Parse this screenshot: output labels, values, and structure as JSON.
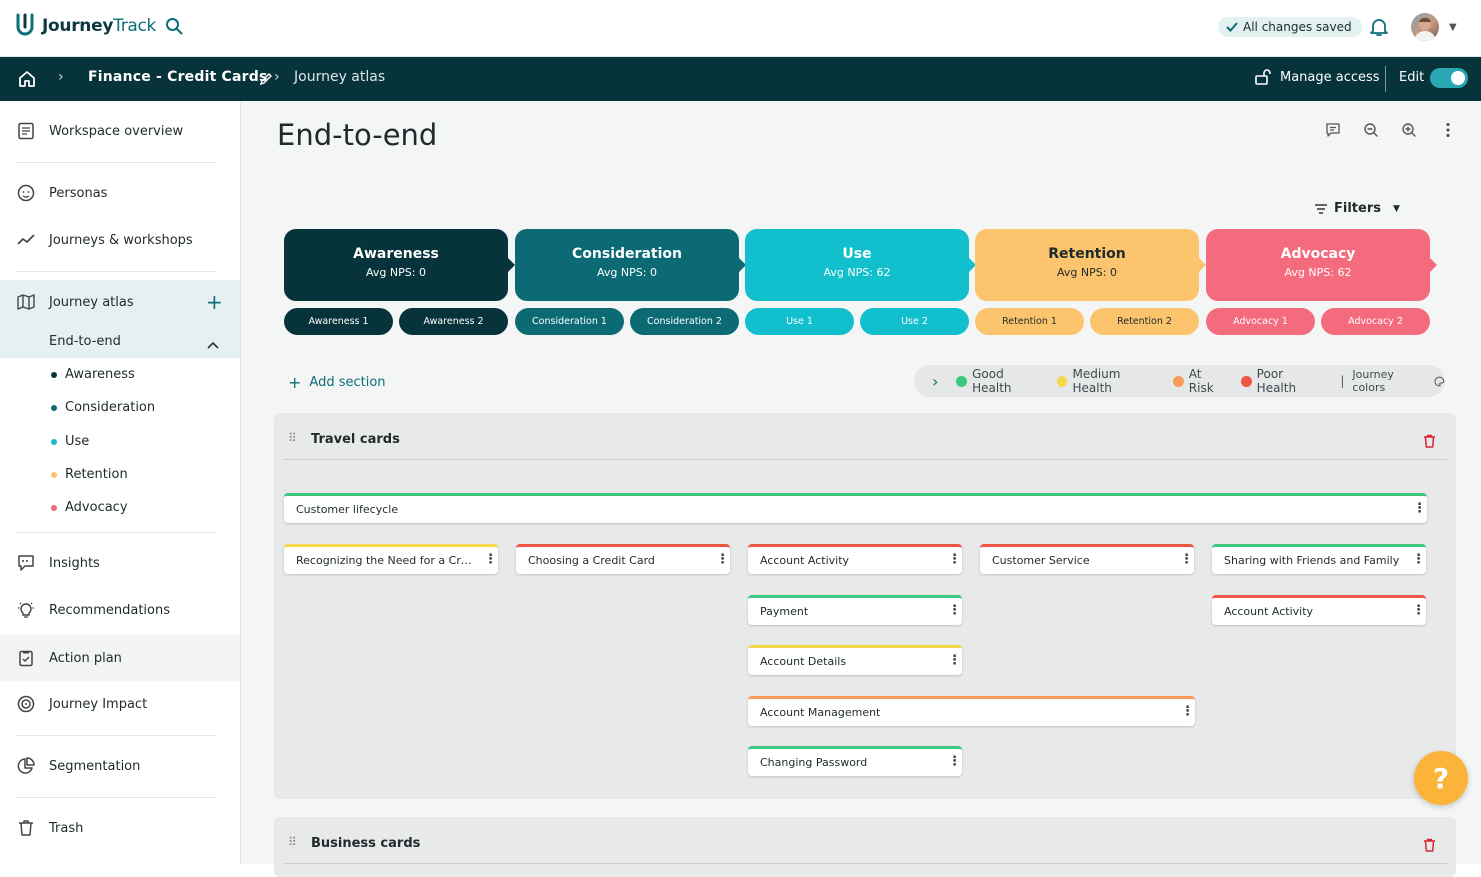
{
  "app": {
    "name_a": "Journey",
    "name_b": "Track",
    "saved_status": "All changes saved"
  },
  "breadcrumb": {
    "workspace": "Finance - Credit Cards",
    "page": "Journey atlas"
  },
  "navbar": {
    "manage_access": "Manage access",
    "edit_label": "Edit",
    "edit_on": true
  },
  "sidebar": {
    "workspace_overview": "Workspace overview",
    "personas": "Personas",
    "journeys": "Journeys & workshops",
    "journey_atlas": "Journey atlas",
    "end_to_end": "End-to-end",
    "phases": [
      {
        "label": "Awareness",
        "color": "#07333a"
      },
      {
        "label": "Consideration",
        "color": "#0d6e78"
      },
      {
        "label": "Use",
        "color": "#14b8c6"
      },
      {
        "label": "Retention",
        "color": "#fbc46a"
      },
      {
        "label": "Advocacy",
        "color": "#f26a7d"
      }
    ],
    "insights": "Insights",
    "recommendations": "Recommendations",
    "action_plan": "Action plan",
    "journey_impact": "Journey Impact",
    "segmentation": "Segmentation",
    "trash": "Trash"
  },
  "main": {
    "title": "End-to-end",
    "filters": "Filters",
    "add_section": "Add section",
    "stages": [
      {
        "name": "Awareness",
        "nps": "Avg NPS: 0",
        "bg": "#07333a",
        "fg": "#ffffff",
        "subs": [
          "Awareness 1",
          "Awareness 2"
        ]
      },
      {
        "name": "Consideration",
        "nps": "Avg NPS: 0",
        "bg": "#0b6a74",
        "fg": "#ffffff",
        "subs": [
          "Consideration 1",
          "Consideration 2"
        ]
      },
      {
        "name": "Use",
        "nps": "Avg NPS: 62",
        "bg": "#12bfcd",
        "fg": "#ffffff",
        "subs": [
          "Use 1",
          "Use 2"
        ]
      },
      {
        "name": "Retention",
        "nps": "Avg NPS: 0",
        "bg": "#fcc46c",
        "fg": "#1e2a2c",
        "subs": [
          "Retention 1",
          "Retention 2"
        ]
      },
      {
        "name": "Advocacy",
        "nps": "Avg NPS: 62",
        "bg": "#f56b7e",
        "fg": "#ffffff",
        "subs": [
          "Advocacy 1",
          "Advocacy 2"
        ]
      }
    ],
    "legend": {
      "items": [
        {
          "label": "Good Health",
          "color": "#3cc97f"
        },
        {
          "label": "Medium Health",
          "color": "#f2d84a"
        },
        {
          "label": "At Risk",
          "color": "#f99c5b"
        },
        {
          "label": "Poor Health",
          "color": "#f0554a"
        }
      ],
      "journey_colors": "Journey colors"
    },
    "sections": [
      {
        "name": "Travel cards",
        "cards": {
          "lifecycle": {
            "text": "Customer lifecycle",
            "health": "#3cc97f"
          },
          "c1": {
            "text": "Recognizing the Need for a Credit Card",
            "health": "#f2d84a"
          },
          "c2": {
            "text": "Choosing a Credit Card",
            "health": "#f0554a"
          },
          "c3": {
            "text": "Account Activity",
            "health": "#f0554a"
          },
          "c4": {
            "text": "Customer Service",
            "health": "#f0554a"
          },
          "c5": {
            "text": "Sharing with Friends and Family",
            "health": "#3cc97f"
          },
          "c6": {
            "text": "Payment",
            "health": "#3cc97f"
          },
          "c7": {
            "text": "Account Activity",
            "health": "#f0554a"
          },
          "c8": {
            "text": "Account Details",
            "health": "#f2d84a"
          },
          "c9": {
            "text": "Account Management",
            "health": "#f99c5b"
          },
          "c10": {
            "text": "Changing Password",
            "health": "#3cc97f"
          }
        }
      },
      {
        "name": "Business cards"
      }
    ],
    "help": "?"
  }
}
